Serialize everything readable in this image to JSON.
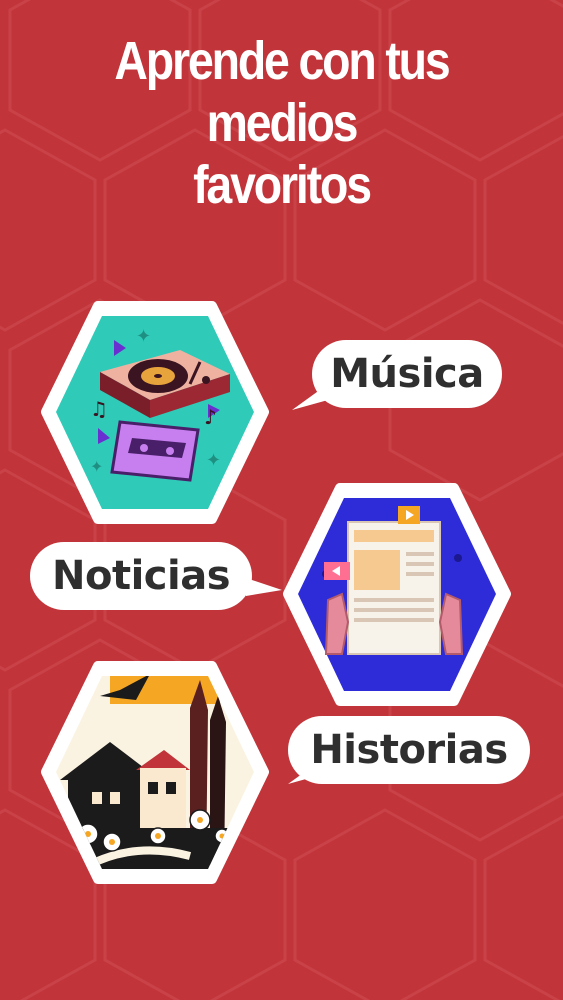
{
  "header": {
    "title_line1": "Aprende con tus medios",
    "title_line2": "favoritos"
  },
  "cards": [
    {
      "label": "Música",
      "icon": "music-turntable-cassette-icon"
    },
    {
      "label": "Noticias",
      "icon": "newspaper-icon"
    },
    {
      "label": "Historias",
      "icon": "story-house-landscape-icon"
    }
  ],
  "colors": {
    "background": "#c13439",
    "music_tile": "#2fcab8",
    "news_tile": "#2e2bd8",
    "bubble": "#ffffff",
    "bubble_text": "#2f2f2f"
  }
}
